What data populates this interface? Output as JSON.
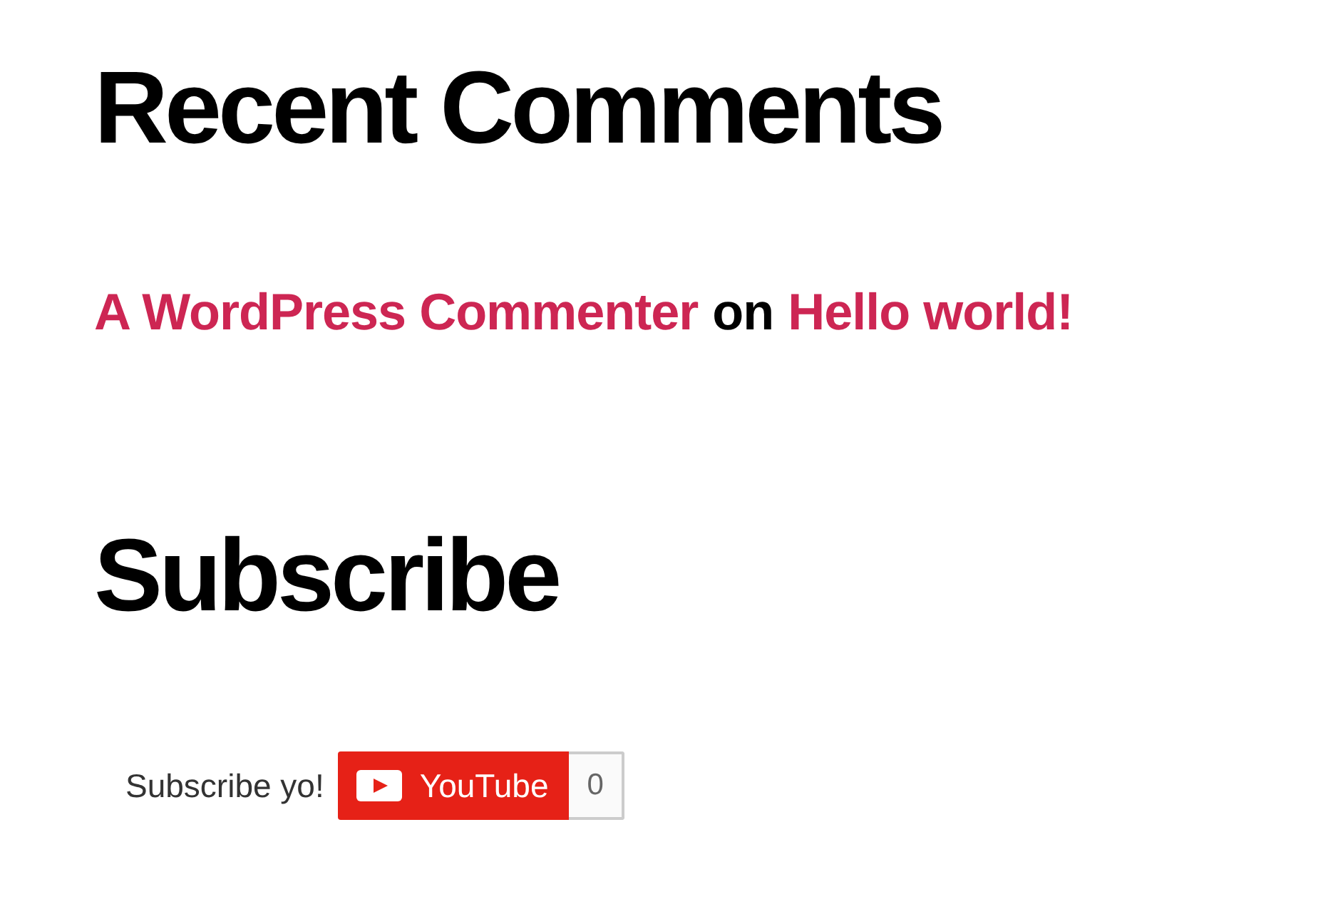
{
  "recent_comments": {
    "title": "Recent Comments",
    "items": [
      {
        "author": "A WordPress Commenter",
        "connector": "on",
        "post": "Hello world!"
      }
    ]
  },
  "subscribe": {
    "title": "Subscribe",
    "label": "Subscribe yo!",
    "button": "YouTube",
    "count": "0"
  }
}
